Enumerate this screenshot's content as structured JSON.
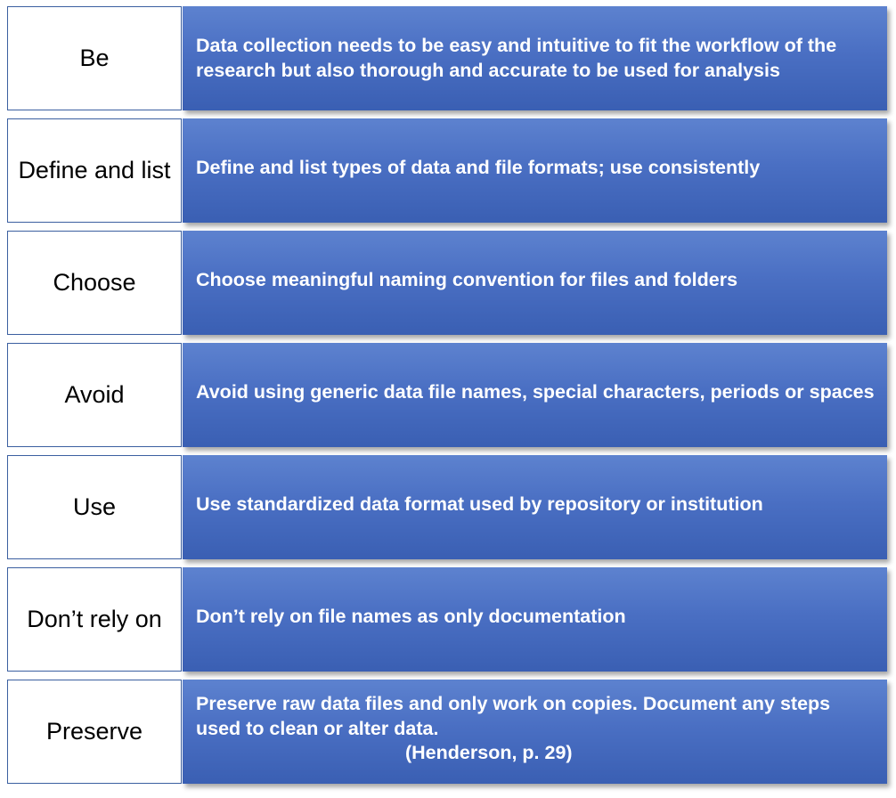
{
  "rows": [
    {
      "keyword": "Be",
      "description": "Data collection needs to be easy and intuitive to fit the workflow of the research but also thorough and accurate to be used for analysis"
    },
    {
      "keyword": "Define and list",
      "description": "Define and list types of data and file formats; use consistently"
    },
    {
      "keyword": "Choose",
      "description": "Choose meaningful naming convention for files and folders"
    },
    {
      "keyword": "Avoid",
      "description": "Avoid using generic data file names, special characters, periods or spaces"
    },
    {
      "keyword": "Use",
      "description": "Use standardized data format used by repository or institution"
    },
    {
      "keyword": "Don’t rely on",
      "description": "Don’t rely on file names as only documentation"
    },
    {
      "keyword": "Preserve",
      "description": "Preserve raw data files and only work on copies. Document any steps used to clean or alter data.",
      "citation": "(Henderson, p. 29)"
    }
  ]
}
